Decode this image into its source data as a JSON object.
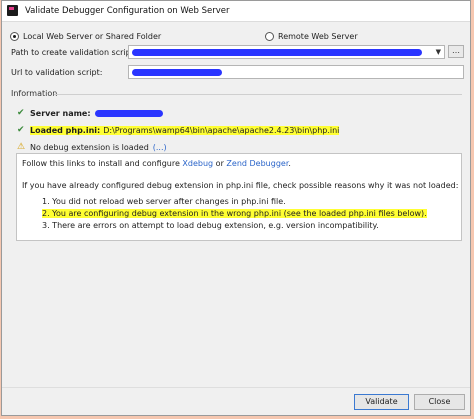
{
  "window": {
    "title": "Validate Debugger Configuration on Web Server"
  },
  "mode": {
    "local_label": "Local Web Server or Shared Folder",
    "remote_label": "Remote Web Server",
    "selected": "local"
  },
  "fields": {
    "path_label": "Path to create validation script:",
    "path_value": "",
    "url_label": "Url to validation script:",
    "url_value": ""
  },
  "info": {
    "section_label": "Information",
    "server_name_label": "Server name:",
    "server_name_value": "",
    "phpini_label": "Loaded php.ini:",
    "phpini_value": "D:\\Programs\\wamp64\\bin\\apache\\apache2.4.23\\bin\\php.ini",
    "no_debug_text": "No debug extension is loaded",
    "no_debug_link": "(...)"
  },
  "message": {
    "line1_prefix": "Follow this links to install and configure ",
    "xdebug_link": "Xdebug",
    "or_text": " or ",
    "zend_link": "Zend Debugger",
    "line1_suffix": ".",
    "line2": "If you have already configured debug extension in php.ini file, check possible reasons why it was not loaded:",
    "items": [
      "1. You did not reload web server after changes in php.ini file.",
      "2. You are configuring debug extension in the wrong php.ini (see the loaded php.ini files below).",
      "3. There are errors on attempt to load debug extension, e.g. version incompatibility."
    ]
  },
  "buttons": {
    "validate": "Validate",
    "close": "Close"
  },
  "colors": {
    "highlight": "#ffff33",
    "scribble": "#2a35ff",
    "link": "#2a64c9",
    "check": "#3b8a3b",
    "warning": "#d39b00"
  }
}
